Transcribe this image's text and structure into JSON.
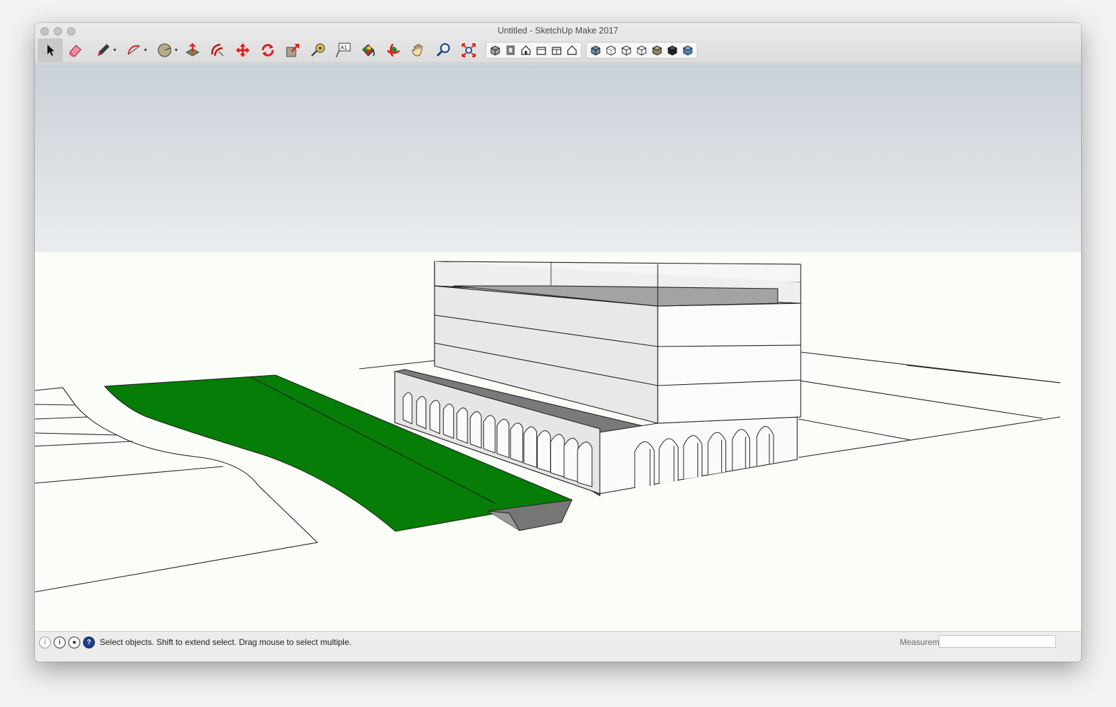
{
  "window": {
    "title": "Untitled - SketchUp Make 2017"
  },
  "toolbar": {
    "tools": [
      {
        "name": "select-tool",
        "icon": "arrow-cursor-icon",
        "selected": true
      },
      {
        "name": "eraser-tool",
        "icon": "eraser-icon"
      },
      {
        "name": "pencil-tool",
        "icon": "pencil-icon",
        "dropdown": true
      },
      {
        "name": "arc-tool",
        "icon": "arc-icon",
        "dropdown": true
      },
      {
        "name": "shapes-tool",
        "icon": "circle-icon",
        "dropdown": true
      },
      {
        "name": "push-pull-tool",
        "icon": "push-pull-icon"
      },
      {
        "name": "offset-tool",
        "icon": "offset-icon"
      },
      {
        "name": "move-tool",
        "icon": "move-icon"
      },
      {
        "name": "rotate-tool",
        "icon": "rotate-icon"
      },
      {
        "name": "scale-tool",
        "icon": "scale-icon"
      },
      {
        "name": "tape-measure-tool",
        "icon": "tape-measure-icon"
      },
      {
        "name": "text-tool",
        "icon": "text-icon",
        "label": "A1"
      },
      {
        "name": "paint-bucket-tool",
        "icon": "paint-bucket-icon"
      },
      {
        "name": "orbit-tool",
        "icon": "orbit-icon"
      },
      {
        "name": "pan-tool",
        "icon": "hand-icon"
      },
      {
        "name": "zoom-tool",
        "icon": "magnifier-icon"
      },
      {
        "name": "zoom-extents-tool",
        "icon": "zoom-extents-icon"
      }
    ],
    "views": [
      "iso-view-icon",
      "top-view-icon",
      "front-view-icon",
      "right-view-icon",
      "back-view-icon",
      "left-view-icon"
    ],
    "styles": [
      "xray-style-icon",
      "back-edges-style-icon",
      "wireframe-style-icon",
      "hidden-line-style-icon",
      "shaded-style-icon",
      "shaded-textures-style-icon",
      "monochrome-style-icon"
    ]
  },
  "status": {
    "message": "Select objects. Shift to extend select. Drag mouse to select multiple.",
    "measurements_label": "Measurements",
    "measurements_value": ""
  },
  "colors": {
    "sky": "#c9d0d7",
    "ground": "#fbfdf9",
    "grass": "#067d06",
    "face_light": "#f4f4f4",
    "face_mid": "#e3e3e3",
    "roof_dark": "#7a7a7a"
  }
}
